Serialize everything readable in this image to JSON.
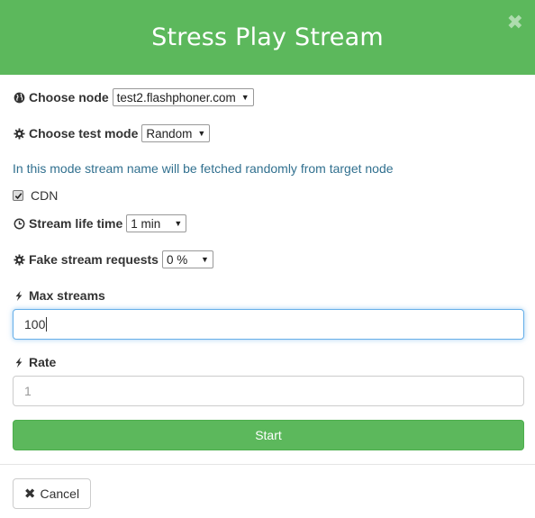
{
  "header": {
    "title": "Stress Play Stream",
    "close_glyph": "✖"
  },
  "node": {
    "label": "Choose node",
    "value": "test2.flashphoner.com",
    "icon": "globe-icon"
  },
  "test_mode": {
    "label": "Choose test mode",
    "value": "Random",
    "icon": "gear-icon"
  },
  "info_text": "In this mode stream name will be fetched randomly from target node",
  "cdn": {
    "label": "CDN",
    "checked": true
  },
  "lifetime": {
    "label": "Stream life time",
    "value": "1 min",
    "icon": "clock-icon"
  },
  "fake": {
    "label": "Fake stream requests",
    "value": "0 %",
    "icon": "gear-icon"
  },
  "max_streams": {
    "label": "Max streams",
    "value": "100",
    "icon": "bolt-icon"
  },
  "rate": {
    "label": "Rate",
    "placeholder": "1",
    "icon": "bolt-icon"
  },
  "start_label": "Start",
  "cancel_label": "Cancel",
  "colors": {
    "header": "#5cb85c",
    "info": "#31708f",
    "focus": "#66afe9"
  }
}
